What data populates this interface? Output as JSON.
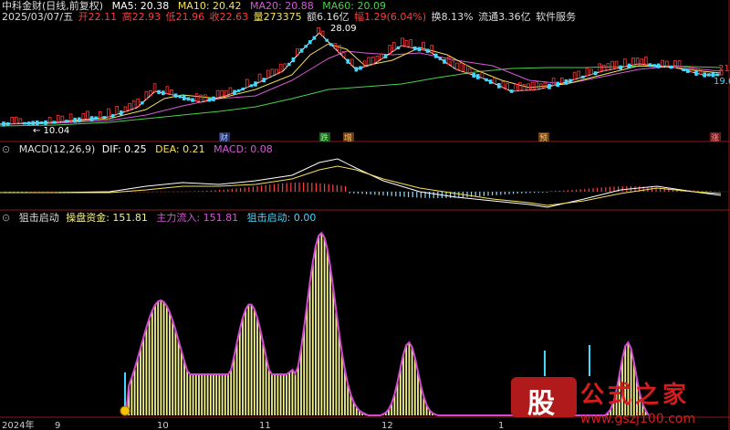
{
  "header": {
    "title": "中科金财(日线,前复权)",
    "ma5": "MA5: 20.38",
    "ma10": "MA10: 20.42",
    "ma20": "MA20: 20.88",
    "ma60": "MA60: 20.09"
  },
  "quote": {
    "date": "2025/03/07/五",
    "open": "开22.11",
    "high": "高22.93",
    "low": "低21.96",
    "close": "收22.63",
    "volume": "量273375",
    "amount": "额6.16亿",
    "change": "幅1.29(6.04%)",
    "turnover": "换8.13%",
    "float": "流通3.36亿",
    "sector": "软件服务"
  },
  "price_labels": {
    "high_mark": "28.09",
    "low_mark": "← 10.04",
    "right_a": "21",
    "right_b": "19.6"
  },
  "events": [
    "财",
    "跌",
    "增",
    "预",
    "涨"
  ],
  "macd": {
    "title": "MACD(12,26,9)",
    "dif": "DIF: 0.25",
    "dea": "DEA: 0.21",
    "macd": "MACD: 0.08"
  },
  "indicator": {
    "title": "狙击启动",
    "fund": "操盘资金: 151.81",
    "main": "主力流入: 151.81",
    "start": "狙击启动: 0.00"
  },
  "axis": {
    "labels": [
      "2024年",
      "9",
      "10",
      "11",
      "12",
      "1"
    ]
  },
  "watermark": {
    "logo_char": "股",
    "brand": "公式之家",
    "url": "www.gszj100.com"
  },
  "colors": {
    "ma5": "#ffffff",
    "ma10": "#f5e15a",
    "ma20": "#d65ad6",
    "ma60": "#4bd04b",
    "up": "#ff3a3a",
    "down": "#40d8ff",
    "bar_yellow": "#f4f28a",
    "outline": "#d24ad2"
  }
}
